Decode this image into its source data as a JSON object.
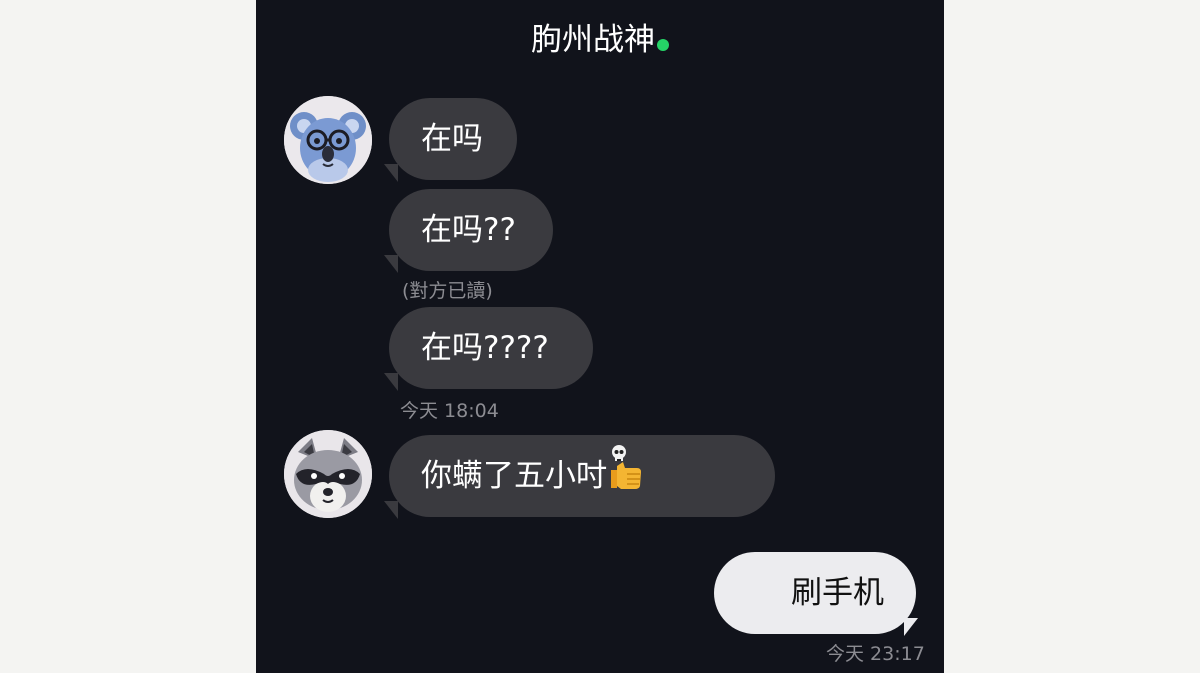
{
  "chat": {
    "title": "朐州战神",
    "status_color": "#25d366"
  },
  "messages": [
    {
      "text": "在吗",
      "sender": "koala"
    },
    {
      "text": "在吗??",
      "sender": "koala"
    },
    {
      "text": "在吗????",
      "sender": "koala"
    },
    {
      "text": "你螨了五小吋",
      "sender": "raccoon",
      "emoji": "skull-thumbs-up-emoji"
    },
    {
      "text": "刷手机",
      "sender": "me"
    }
  ],
  "meta": {
    "read_receipt": "(對方已讀)",
    "time_1": "今天 18:04",
    "time_2": "今天 23:17"
  },
  "colors": {
    "background": "#11131b",
    "incoming_bubble": "#3a3a3f",
    "outgoing_bubble": "#ececef"
  }
}
